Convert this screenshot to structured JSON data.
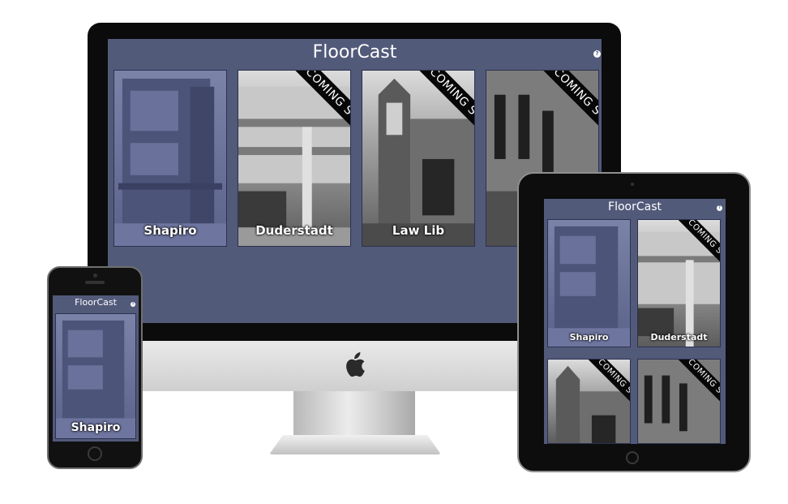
{
  "app": {
    "title": "FloorCast",
    "help_glyph": "?",
    "help_icon": "help-circle-icon"
  },
  "colors": {
    "screen_bg": "#525a7a",
    "title_text": "#ffffff",
    "ribbon": "#070707"
  },
  "devices": {
    "imac": {
      "tiles": [
        {
          "label": "Shapiro",
          "status": ""
        },
        {
          "label": "Duderstadt",
          "status": "COMING SOON"
        },
        {
          "label": "Law Lib",
          "status": "COMING SOON"
        },
        {
          "label": "",
          "status": "COMING SOON"
        }
      ]
    },
    "ipad": {
      "tiles": [
        {
          "label": "Shapiro",
          "status": ""
        },
        {
          "label": "Duderstadt",
          "status": "COMING SOON"
        },
        {
          "label": "",
          "status": "COMING SOON"
        },
        {
          "label": "",
          "status": "COMING SOON"
        }
      ]
    },
    "iphone": {
      "tiles": [
        {
          "label": "Shapiro",
          "status": ""
        }
      ]
    }
  }
}
